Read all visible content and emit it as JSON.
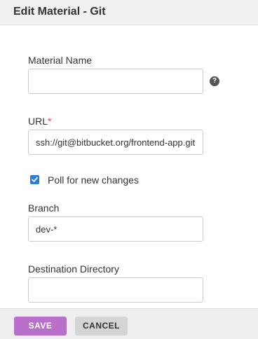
{
  "dialog": {
    "title": "Edit Material - Git"
  },
  "form": {
    "material_name": {
      "label": "Material Name",
      "value": "",
      "help_icon": "question-mark-icon",
      "help_glyph": "?"
    },
    "url": {
      "label": "URL",
      "required_marker": "*",
      "value": "ssh://git@bitbucket.org/frontend-app.git"
    },
    "poll": {
      "label": "Poll for new changes",
      "checked": true
    },
    "branch": {
      "label": "Branch",
      "value": "dev-*"
    },
    "destination": {
      "label": "Destination Directory",
      "value": ""
    }
  },
  "footer": {
    "save_label": "SAVE",
    "cancel_label": "CANCEL"
  },
  "colors": {
    "save_button": "#b86fc9",
    "checkbox": "#2d7bd8",
    "required": "#d9534f"
  }
}
